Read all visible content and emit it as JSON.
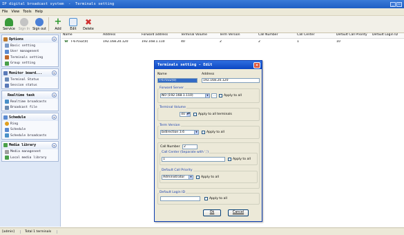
{
  "window": {
    "title": "IP digital broadcast system  -  Terminals setting"
  },
  "menu": [
    "File",
    "View",
    "Tools",
    "Help"
  ],
  "toolbar": [
    {
      "label": "Service",
      "icon": "service-icon",
      "enabled": true,
      "color": "#3a9a3a"
    },
    {
      "label": "Sign In",
      "icon": "sign-in-icon",
      "enabled": false,
      "color": "#b8b8b8"
    },
    {
      "label": "Sign out",
      "icon": "sign-out-icon",
      "enabled": true,
      "color": "#4a7fd6"
    },
    {
      "label": "Add",
      "icon": "add-icon",
      "enabled": true,
      "color": "#2e9a2e"
    },
    {
      "label": "Edit",
      "icon": "edit-icon",
      "enabled": true,
      "color": "#4a8fd0"
    },
    {
      "label": "Delete",
      "icon": "delete-icon",
      "enabled": true,
      "color": "#d03030"
    }
  ],
  "sidebar": {
    "sections": [
      {
        "title": "Options",
        "items": [
          {
            "label": "Basic setting",
            "icon": "basic-setting-icon",
            "color": "#7a9ac8"
          },
          {
            "label": "User managenent",
            "icon": "user-management-icon",
            "color": "#5a8ad0"
          },
          {
            "label": "Terminals setting",
            "icon": "terminal-setting-icon",
            "color": "#c0682a"
          },
          {
            "label": "Group setting",
            "icon": "group-setting-icon",
            "color": "#4aa04a"
          }
        ]
      },
      {
        "title": "Monitor board...",
        "items": [
          {
            "label": "Terminal Status",
            "icon": "terminal-status-icon",
            "color": "#6a8ab8"
          },
          {
            "label": "Session status",
            "icon": "session-status-icon",
            "color": "#5a7ab8"
          }
        ]
      },
      {
        "title": "Realtime task",
        "items": [
          {
            "label": "Realtime broadcasts",
            "icon": "realtime-broadcast-icon",
            "color": "#4a90c8"
          },
          {
            "label": "Broadcast file",
            "icon": "broadcast-file-icon",
            "color": "#6a8ab0"
          }
        ]
      },
      {
        "title": "Schedule",
        "items": [
          {
            "label": "Ring",
            "icon": "ring-icon",
            "color": "#e0a020"
          },
          {
            "label": "Schedule",
            "icon": "schedule-icon",
            "color": "#5a8ad0"
          },
          {
            "label": "Schedule broadcasts",
            "icon": "schedule-broadcast-icon",
            "color": "#4a90c8"
          }
        ]
      },
      {
        "title": "Media library",
        "items": [
          {
            "label": "Media managenent",
            "icon": "media-management-icon",
            "color": "#a0a0a0"
          },
          {
            "label": "Local media library",
            "icon": "local-media-icon",
            "color": "#4aa04a"
          }
        ]
      }
    ]
  },
  "table": {
    "headers": [
      "Name",
      "Address",
      "Forward address",
      "Terminal Volume",
      "Term Version",
      "Call Number",
      "Call Center",
      "Default Call Priority",
      "Default Login ID"
    ],
    "rows": [
      [
        "T-67032(0)",
        "192.168.20.120",
        "192.168.1.110",
        "40",
        "2",
        "2",
        "1",
        "10",
        ""
      ]
    ]
  },
  "status": {
    "user": "[admin]",
    "total": "Total 1 terminals"
  },
  "dialog": {
    "title": "Terminals setting - Edit",
    "name_label": "Name",
    "name_value": "T-67032(0)",
    "address_label": "Address",
    "address_value": "192.168.20.120",
    "forward_label": "Forward Server",
    "forward_value": "NO (192.168.1.110)",
    "forward_apply": "Apply to all",
    "volume_label": "Terminal Volume",
    "volume_value": "40",
    "volume_apply": "Apply to all terminals",
    "version_label": "Term Version",
    "version_value": "bidirection 3.6",
    "version_apply": "Apply to all",
    "callnum_label": "Call Number",
    "callnum_value": "2",
    "callcenter_label": "Call Center (Separate with ',')",
    "callcenter_value": "1",
    "callcenter_apply": "Apply to all",
    "priority_label": "Default Call Priority",
    "priority_value": "Administrator",
    "priority_apply": "Apply to all",
    "login_label": "Default Login ID",
    "login_value": "",
    "login_apply": "Apply to all",
    "ok_label": "Ok",
    "cancel_label": "Cancel"
  }
}
